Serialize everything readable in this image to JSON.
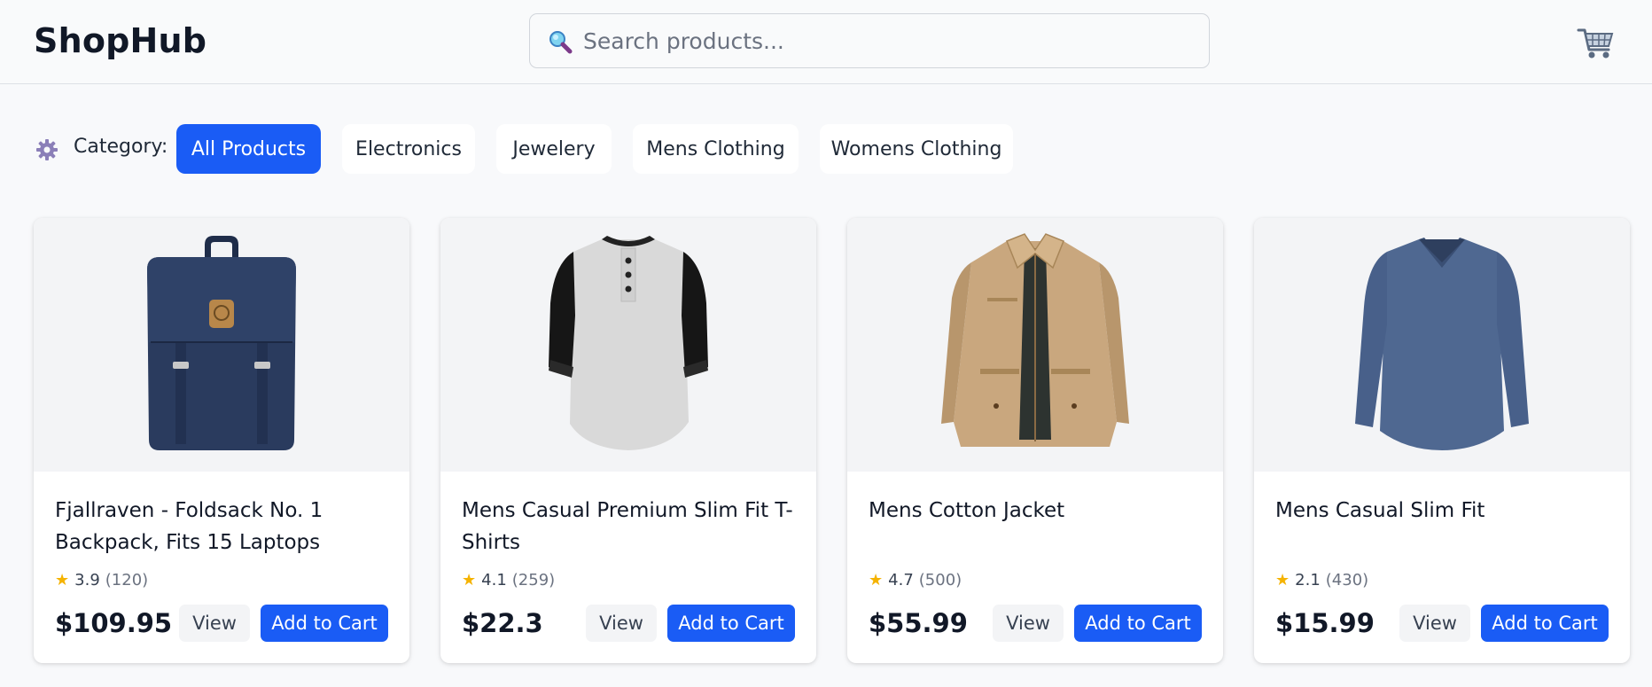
{
  "header": {
    "brand": "ShopHub",
    "search_placeholder": "Search products...",
    "search_value": "",
    "search_icon": "magnifier-icon",
    "cart_icon": "shopping-cart-icon"
  },
  "categories": {
    "label": "Category:",
    "icon": "gear-icon",
    "items": [
      {
        "label": "All Products",
        "active": true
      },
      {
        "label": "Electronics",
        "active": false
      },
      {
        "label": "Jewelery",
        "active": false
      },
      {
        "label": "Mens Clothing",
        "active": false
      },
      {
        "label": "Womens Clothing",
        "active": false
      }
    ]
  },
  "products": [
    {
      "title": "Fjallraven - Foldsack No. 1 Backpack, Fits 15 Laptops",
      "rating": "3.9",
      "count": "(120)",
      "price": "$109.95",
      "image": "navy-backpack"
    },
    {
      "title": "Mens Casual Premium Slim Fit T-Shirts",
      "rating": "4.1",
      "count": "(259)",
      "price": "$22.3",
      "image": "raglan-henley-shirt"
    },
    {
      "title": "Mens Cotton Jacket",
      "rating": "4.7",
      "count": "(500)",
      "price": "$55.99",
      "image": "khaki-jacket"
    },
    {
      "title": "Mens Casual Slim Fit",
      "rating": "2.1",
      "count": "(430)",
      "price": "$15.99",
      "image": "blue-long-sleeve-shirt"
    }
  ],
  "card_actions": {
    "view_label": "View",
    "add_label": "Add to Cart"
  },
  "colors": {
    "primary": "#1a5cf5",
    "star": "#f5b301",
    "background": "#f8f9fb"
  }
}
